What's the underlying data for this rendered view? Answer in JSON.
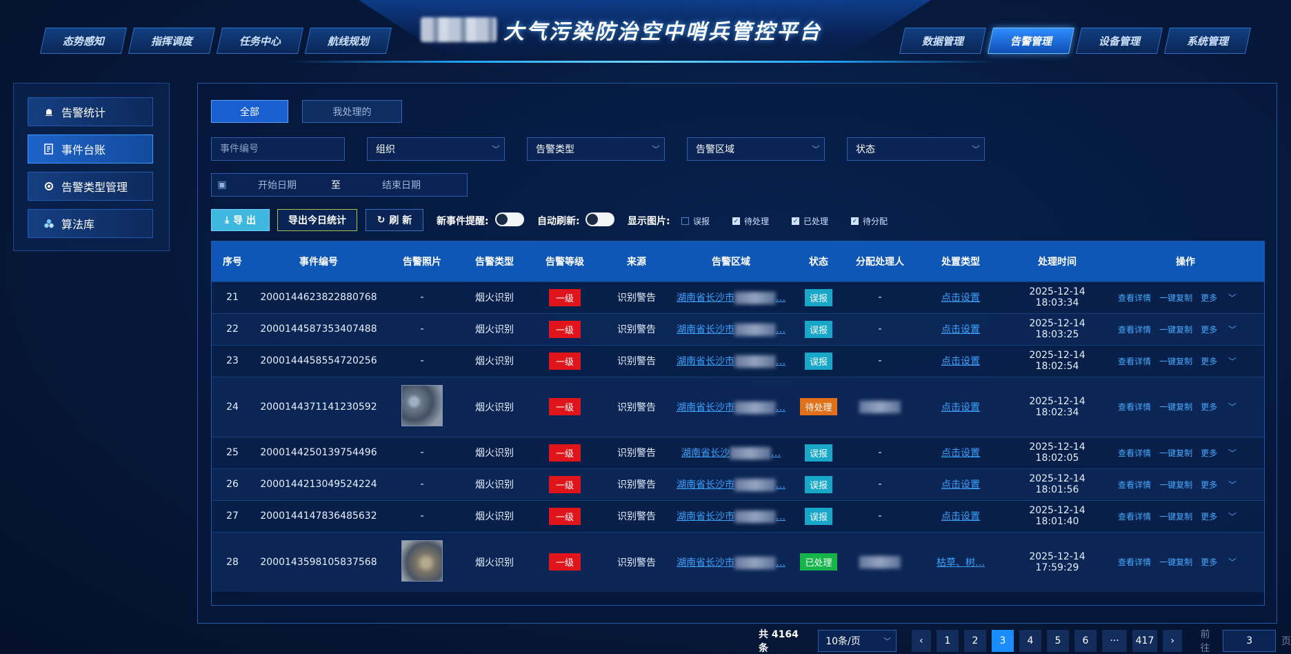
{
  "header": {
    "title": "大气污染防治空中哨兵管控平台",
    "nav_left": [
      "态势感知",
      "指挥调度",
      "任务中心",
      "航线规划"
    ],
    "nav_right": [
      "数据管理",
      "告警管理",
      "设备管理",
      "系统管理"
    ],
    "active_nav": "告警管理"
  },
  "sidebar": {
    "items": [
      {
        "label": "告警统计",
        "icon": "alarm-icon"
      },
      {
        "label": "事件台账",
        "icon": "ledger-icon"
      },
      {
        "label": "告警类型管理",
        "icon": "settings-icon"
      },
      {
        "label": "算法库",
        "icon": "algorithm-icon"
      }
    ],
    "active": "事件台账"
  },
  "tabs": {
    "all": "全部",
    "mine": "我处理的"
  },
  "filters": {
    "event_no_placeholder": "事件编号",
    "org": "组织",
    "alarm_type": "告警类型",
    "alarm_area": "告警区域",
    "status": "状态",
    "start_date": "开始日期",
    "to": "至",
    "end_date": "结束日期"
  },
  "actions": {
    "export": "导 出",
    "export_today": "导出今日统计",
    "refresh": "刷 新",
    "new_event_label": "新事件提醒:",
    "auto_refresh_label": "自动刷新:",
    "show_image_label": "显示图片:",
    "checks": [
      {
        "label": "误报",
        "checked": false
      },
      {
        "label": "待处理",
        "checked": true
      },
      {
        "label": "已处理",
        "checked": true
      },
      {
        "label": "待分配",
        "checked": true
      }
    ]
  },
  "table": {
    "columns": [
      "序号",
      "事件编号",
      "告警照片",
      "告警类型",
      "告警等级",
      "来源",
      "告警区域",
      "状态",
      "分配处理人",
      "处置类型",
      "处理时间",
      "操作"
    ],
    "ops": {
      "detail": "查看详情",
      "copy": "一键复制",
      "more": "更多"
    },
    "rows": [
      {
        "no": "21",
        "id": "2000144623822880768",
        "photo": "-",
        "type": "烟火识别",
        "level": "一级",
        "source": "识别警告",
        "area": "湖南省长沙市",
        "status": "误报",
        "status_color": "blue",
        "assignee": "-",
        "handle": "点击设置",
        "time": "2025-12-14 18:03:34"
      },
      {
        "no": "22",
        "id": "2000144587353407488",
        "photo": "-",
        "type": "烟火识别",
        "level": "一级",
        "source": "识别警告",
        "area": "湖南省长沙市",
        "status": "误报",
        "status_color": "blue",
        "assignee": "-",
        "handle": "点击设置",
        "time": "2025-12-14 18:03:25"
      },
      {
        "no": "23",
        "id": "2000144458554720256",
        "photo": "-",
        "type": "烟火识别",
        "level": "一级",
        "source": "识别警告",
        "area": "湖南省长沙市",
        "status": "误报",
        "status_color": "blue",
        "assignee": "-",
        "handle": "点击设置",
        "time": "2025-12-14 18:02:54"
      },
      {
        "no": "24",
        "id": "2000144371141230592",
        "photo": "image",
        "type": "烟火识别",
        "level": "一级",
        "source": "识别警告",
        "area": "湖南省长沙市",
        "status": "待处理",
        "status_color": "orange",
        "assignee": "blurred",
        "handle": "点击设置",
        "time": "2025-12-14 18:02:34"
      },
      {
        "no": "25",
        "id": "2000144250139754496",
        "photo": "-",
        "type": "烟火识别",
        "level": "一级",
        "source": "识别警告",
        "area": "湖南省长沙",
        "status": "误报",
        "status_color": "blue",
        "assignee": "-",
        "handle": "点击设置",
        "time": "2025-12-14 18:02:05"
      },
      {
        "no": "26",
        "id": "2000144213049524224",
        "photo": "-",
        "type": "烟火识别",
        "level": "一级",
        "source": "识别警告",
        "area": "湖南省长沙市",
        "status": "误报",
        "status_color": "blue",
        "assignee": "-",
        "handle": "点击设置",
        "time": "2025-12-14 18:01:56"
      },
      {
        "no": "27",
        "id": "2000144147836485632",
        "photo": "-",
        "type": "烟火识别",
        "level": "一级",
        "source": "识别警告",
        "area": "湖南省长沙市",
        "status": "误报",
        "status_color": "blue",
        "assignee": "-",
        "handle": "点击设置",
        "time": "2025-12-14 18:01:40"
      },
      {
        "no": "28",
        "id": "2000143598105837568",
        "photo": "image",
        "type": "烟火识别",
        "level": "一级",
        "source": "识别警告",
        "area": "湖南省长沙市",
        "status": "已处理",
        "status_color": "green",
        "assignee": "blurred",
        "handle": "枯草、树…",
        "time": "2025-12-14 17:59:29"
      }
    ]
  },
  "pagination": {
    "total": "共 4164 条",
    "page_size": "10条/页",
    "pages": [
      "1",
      "2",
      "3",
      "4",
      "5",
      "6",
      "···",
      "417"
    ],
    "current": "3",
    "goto_label": "前往",
    "goto_value": "3",
    "goto_unit": "页"
  }
}
